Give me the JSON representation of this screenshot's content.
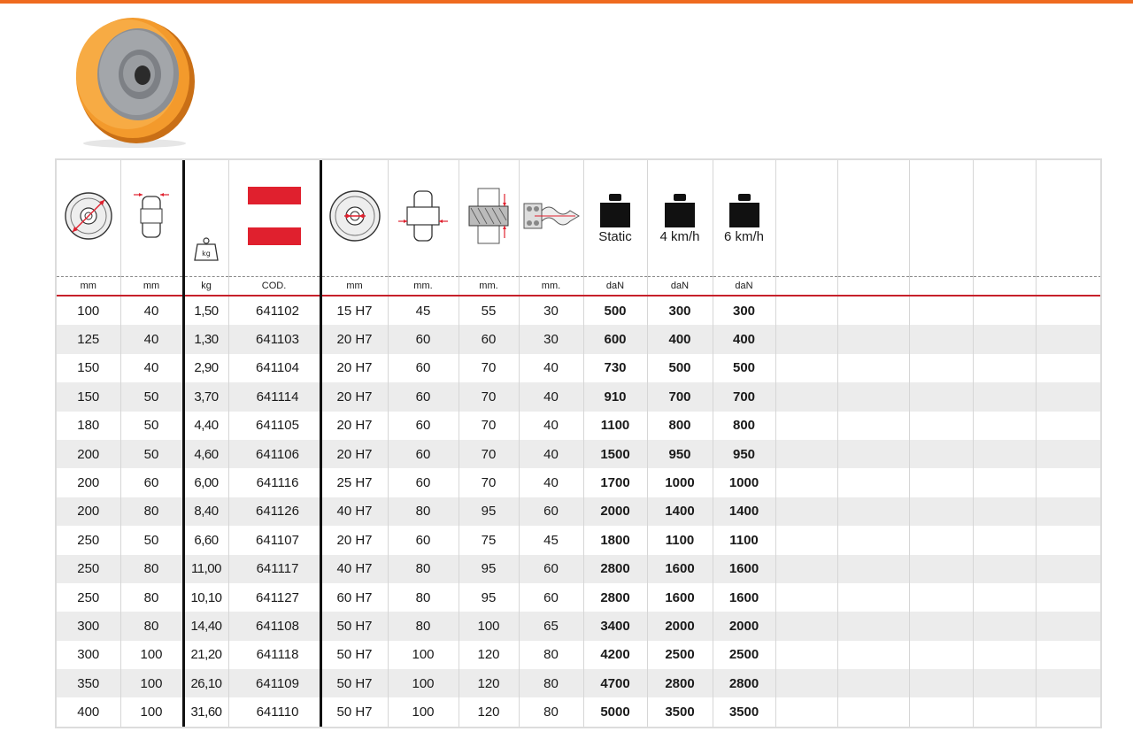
{
  "colors": {
    "accent_bar": "#ef6a1f",
    "red_marker": "#e0202e",
    "header_rule": "#c7202b",
    "row_stripe": "#ececec"
  },
  "icons": {
    "photo": "polyurethane-wheel-icon",
    "col1": "wheel-diameter-icon",
    "col2": "wheel-width-icon",
    "col3": "weight-kg-icon",
    "col4": "red-stripe-marker-icon",
    "col5": "bore-diameter-icon",
    "col6": "hub-length-icon",
    "col7": "hub-section-icon",
    "col8": "bearing-icon",
    "col9": "static-load-weight-icon",
    "col10": "load-4kmh-weight-icon",
    "col11": "load-6kmh-weight-icon"
  },
  "header": {
    "load_labels": [
      "Static",
      "4 km/h",
      "6 km/h"
    ],
    "units": [
      "mm",
      "mm",
      "kg",
      "COD.",
      "mm",
      "mm.",
      "mm.",
      "mm.",
      "daN",
      "daN",
      "daN"
    ]
  },
  "rows": [
    [
      "100",
      "40",
      "1,50",
      "641102",
      "15 H7",
      "45",
      "55",
      "30",
      "500",
      "300",
      "300"
    ],
    [
      "125",
      "40",
      "1,30",
      "641103",
      "20 H7",
      "60",
      "60",
      "30",
      "600",
      "400",
      "400"
    ],
    [
      "150",
      "40",
      "2,90",
      "641104",
      "20 H7",
      "60",
      "70",
      "40",
      "730",
      "500",
      "500"
    ],
    [
      "150",
      "50",
      "3,70",
      "641114",
      "20 H7",
      "60",
      "70",
      "40",
      "910",
      "700",
      "700"
    ],
    [
      "180",
      "50",
      "4,40",
      "641105",
      "20 H7",
      "60",
      "70",
      "40",
      "1100",
      "800",
      "800"
    ],
    [
      "200",
      "50",
      "4,60",
      "641106",
      "20 H7",
      "60",
      "70",
      "40",
      "1500",
      "950",
      "950"
    ],
    [
      "200",
      "60",
      "6,00",
      "641116",
      "25 H7",
      "60",
      "70",
      "40",
      "1700",
      "1000",
      "1000"
    ],
    [
      "200",
      "80",
      "8,40",
      "641126",
      "40 H7",
      "80",
      "95",
      "60",
      "2000",
      "1400",
      "1400"
    ],
    [
      "250",
      "50",
      "6,60",
      "641107",
      "20 H7",
      "60",
      "75",
      "45",
      "1800",
      "1100",
      "1100"
    ],
    [
      "250",
      "80",
      "11,00",
      "641117",
      "40 H7",
      "80",
      "95",
      "60",
      "2800",
      "1600",
      "1600"
    ],
    [
      "250",
      "80",
      "10,10",
      "641127",
      "60 H7",
      "80",
      "95",
      "60",
      "2800",
      "1600",
      "1600"
    ],
    [
      "300",
      "80",
      "14,40",
      "641108",
      "50 H7",
      "80",
      "100",
      "65",
      "3400",
      "2000",
      "2000"
    ],
    [
      "300",
      "100",
      "21,20",
      "641118",
      "50 H7",
      "100",
      "120",
      "80",
      "4200",
      "2500",
      "2500"
    ],
    [
      "350",
      "100",
      "26,10",
      "641109",
      "50 H7",
      "100",
      "120",
      "80",
      "4700",
      "2800",
      "2800"
    ],
    [
      "400",
      "100",
      "31,60",
      "641110",
      "50 H7",
      "100",
      "120",
      "80",
      "5000",
      "3500",
      "3500"
    ]
  ]
}
